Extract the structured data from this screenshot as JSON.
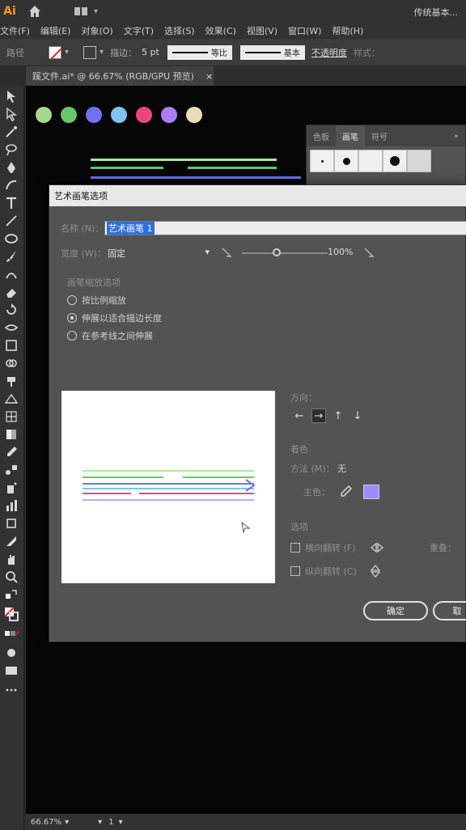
{
  "app": {
    "logo": "Ai",
    "workspace": "传统基本..."
  },
  "menu": [
    "文件(F)",
    "编辑(E)",
    "对象(O)",
    "文字(T)",
    "选择(S)",
    "效果(C)",
    "视图(V)",
    "窗口(W)",
    "帮助(H)"
  ],
  "control": {
    "label": "路径",
    "stroke_label": "描边：",
    "stroke_value": "5 pt",
    "profile1": "等比",
    "profile2": "基本",
    "opacity": "不透明度",
    "style": "样式："
  },
  "document_tab": {
    "title": "蹊文件.ai* @ 66.67% (RGB/GPU 预览)",
    "close": "×"
  },
  "swatch_colors": [
    "#a6d98c",
    "#64c76a",
    "#6f73f0",
    "#7fc4f0",
    "#f0457b",
    "#a97ef7",
    "#ecdcb4"
  ],
  "brush_panel": {
    "tabs": [
      "色板",
      "画笔",
      "符号"
    ],
    "active_tab": 1,
    "more": "»"
  },
  "dialog": {
    "title": "艺术画笔选项",
    "name_label": "名称 (N)：",
    "name_value": "艺术画笔 1",
    "width_label": "宽度 (W)：",
    "width_value": "固定",
    "width_percent": "100%",
    "scale_section": "画笔缩放选项",
    "scale_options": [
      "按比例缩放",
      "伸展以适合描边长度",
      "在参考线之间伸展"
    ],
    "scale_selected": 1,
    "direction_label": "方向：",
    "direction_arrows": [
      "←",
      "→",
      "↑",
      "↓"
    ],
    "direction_selected": 1,
    "colorize_label": "着色",
    "method_label": "方法 (M)：",
    "method_value": "无",
    "key_color_label": "主色：",
    "key_color": "#9b8cff",
    "options_label": "选项",
    "flip_along": "横向翻转 (F)",
    "flip_across": "纵向翻转 (C)",
    "overlap_label": "重叠：",
    "ok": "确定",
    "cancel": "取"
  },
  "status": {
    "zoom": "66.67%",
    "page": "1"
  }
}
